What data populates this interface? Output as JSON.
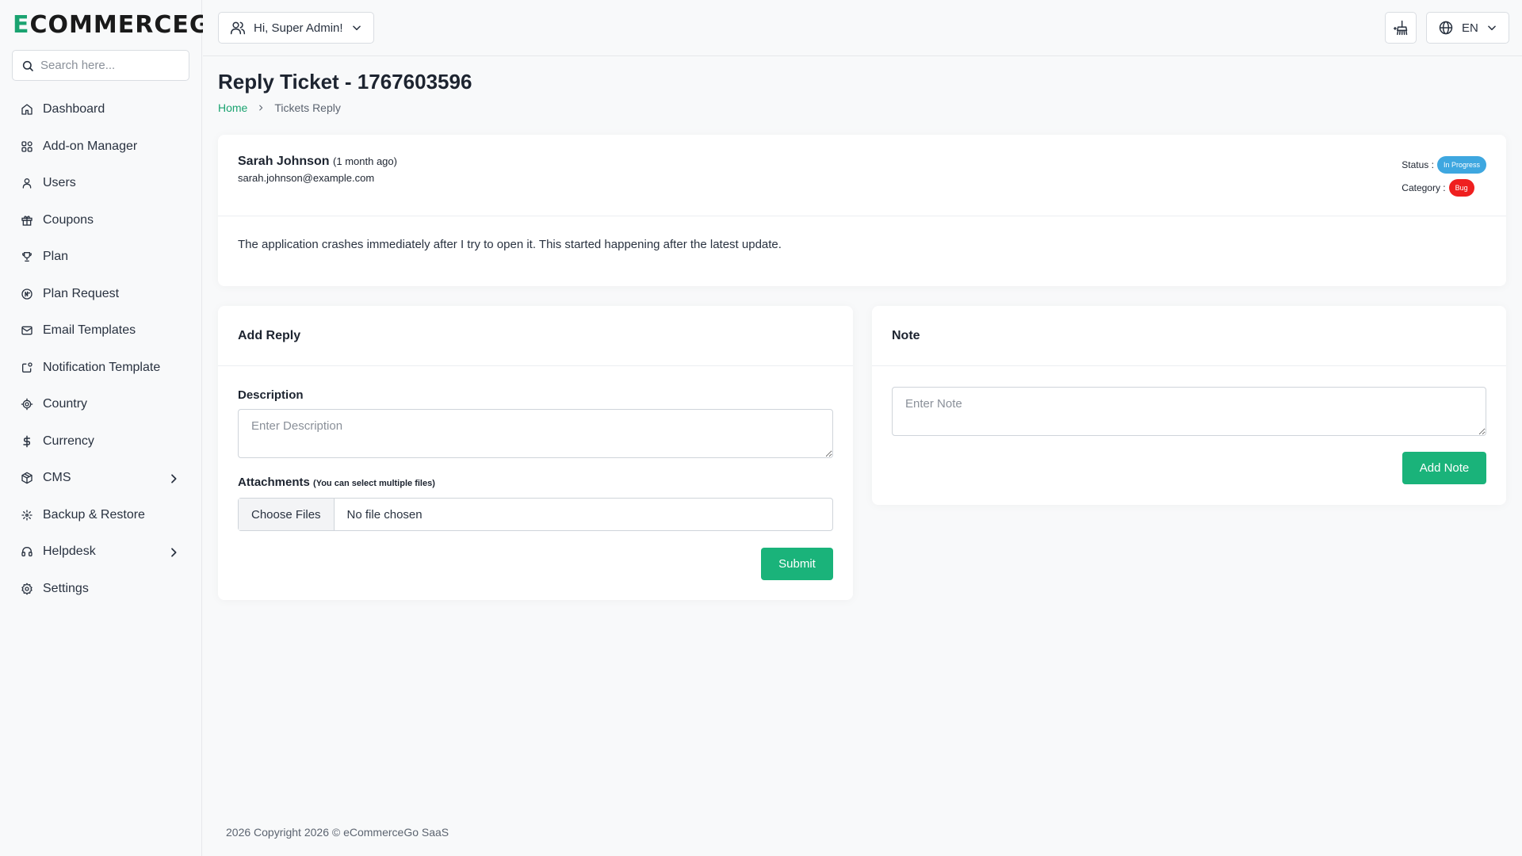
{
  "brand": {
    "logo_accent": "E",
    "logo_rest": "COMMERCEGO",
    "accent_color": "#1aa370"
  },
  "sidebar": {
    "search_placeholder": "Search here...",
    "items": [
      {
        "label": "Dashboard",
        "icon": "home-icon"
      },
      {
        "label": "Add-on Manager",
        "icon": "grid-icon"
      },
      {
        "label": "Users",
        "icon": "user-icon"
      },
      {
        "label": "Coupons",
        "icon": "gift-icon"
      },
      {
        "label": "Plan",
        "icon": "trophy-icon"
      },
      {
        "label": "Plan Request",
        "icon": "badge-icon"
      },
      {
        "label": "Email Templates",
        "icon": "mail-icon"
      },
      {
        "label": "Notification Template",
        "icon": "notification-icon"
      },
      {
        "label": "Country",
        "icon": "target-icon"
      },
      {
        "label": "Currency",
        "icon": "dollar-icon"
      },
      {
        "label": "CMS",
        "icon": "box-icon",
        "has_submenu": true
      },
      {
        "label": "Backup & Restore",
        "icon": "backup-icon"
      },
      {
        "label": "Helpdesk",
        "icon": "headset-icon",
        "has_submenu": true
      },
      {
        "label": "Settings",
        "icon": "gear-icon"
      }
    ]
  },
  "header": {
    "user_greeting": "Hi, Super Admin!",
    "language": "EN"
  },
  "page": {
    "title": "Reply Ticket - 1767603596",
    "breadcrumb_home": "Home",
    "breadcrumb_current": "Tickets Reply"
  },
  "ticket": {
    "name": "Sarah Johnson",
    "time_ago": "(1 month ago)",
    "email": "sarah.johnson@example.com",
    "status_label": "Status :",
    "status_value": "In Progress",
    "category_label": "Category :",
    "category_value": "Bug",
    "description": "The application crashes immediately after I try to open it. This started happening after the latest update."
  },
  "reply": {
    "title": "Add Reply",
    "description_label": "Description",
    "description_placeholder": "Enter Description",
    "attachments_label": "Attachments",
    "attachments_hint": "(You can select multiple files)",
    "choose_files": "Choose Files",
    "no_file": "No file chosen",
    "submit": "Submit"
  },
  "note": {
    "title": "Note",
    "placeholder": "Enter Note",
    "add_button": "Add Note"
  },
  "footer": {
    "copyright": "2026 Copyright 2026 © eCommerceGo SaaS"
  }
}
